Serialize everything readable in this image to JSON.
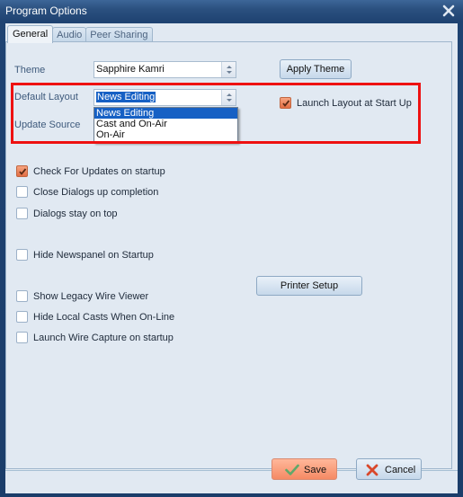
{
  "window": {
    "title": "Program Options",
    "close_icon": "close-x-icon"
  },
  "tabs": [
    {
      "label": "General",
      "active": true
    },
    {
      "label": "Audio",
      "active": false
    },
    {
      "label": "Peer Sharing",
      "active": false
    }
  ],
  "general": {
    "theme": {
      "label": "Theme",
      "value": "Sapphire Kamri"
    },
    "apply_theme_label": "Apply Theme",
    "default_layout": {
      "label": "Default Layout",
      "value": "News Editing",
      "options": [
        "News Editing",
        "Cast and On-Air",
        "On-Air"
      ],
      "selected_option": "News Editing",
      "expanded": true
    },
    "update_source": {
      "label": "Update Source"
    },
    "launch_layout": {
      "label": "Launch Layout at Start Up",
      "checked": true
    },
    "checkboxes": [
      {
        "label": "Check For Updates on startup",
        "checked": true
      },
      {
        "label": "Close Dialogs up completion",
        "checked": false
      },
      {
        "label": "Dialogs stay on top",
        "checked": false
      },
      {
        "label": "Hide Newspanel on Startup",
        "checked": false
      },
      {
        "label": "Show Legacy Wire Viewer",
        "checked": false
      },
      {
        "label": "Hide Local Casts When On-Line",
        "checked": false
      },
      {
        "label": "Launch Wire Capture on startup",
        "checked": false
      }
    ],
    "printer_setup_label": "Printer Setup"
  },
  "footer": {
    "save_label": "Save",
    "cancel_label": "Cancel"
  },
  "colors": {
    "highlight": "#ee1111",
    "selection": "#1660c4",
    "check_accent": "#e26e44",
    "title_bar": "#1f4372"
  }
}
